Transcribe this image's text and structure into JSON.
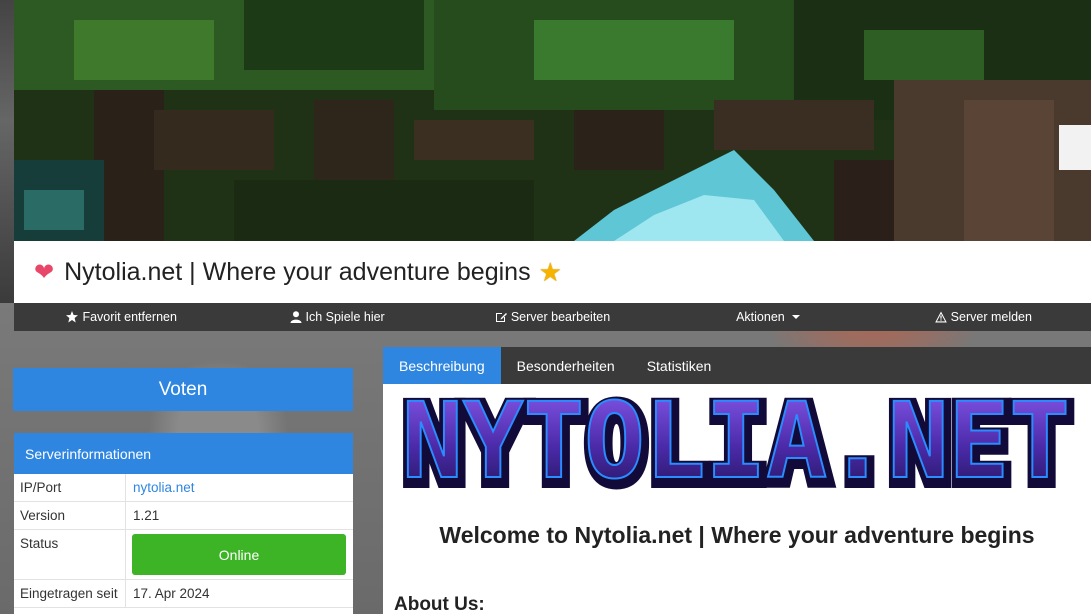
{
  "server": {
    "title": "Nytolia.net | Where your adventure begins",
    "heart_icon": "heart-icon",
    "star_icon": "star-icon"
  },
  "actions": [
    {
      "label": "Favorit entfernen",
      "icon": "star-icon"
    },
    {
      "label": "Ich Spiele hier",
      "icon": "user-icon"
    },
    {
      "label": "Server bearbeiten",
      "icon": "edit-icon"
    },
    {
      "label": "Aktionen",
      "icon": "caret-down-icon"
    },
    {
      "label": "Server melden",
      "icon": "warning-icon"
    }
  ],
  "vote": {
    "label": "Voten"
  },
  "info": {
    "heading": "Serverinformationen",
    "rows": [
      {
        "key": "IP/Port",
        "value": "nytolia.net"
      },
      {
        "key": "Version",
        "value": "1.21"
      },
      {
        "key": "Status",
        "value": "Online"
      },
      {
        "key": "Eingetragen seit",
        "value": "17. Apr 2024"
      }
    ]
  },
  "tabs": [
    {
      "label": "Beschreibung",
      "active": true
    },
    {
      "label": "Besonderheiten",
      "active": false
    },
    {
      "label": "Statistiken",
      "active": false
    }
  ],
  "content": {
    "logo_text": "NYTOLIA.NET",
    "welcome": "Welcome to Nytolia.net | Where your adventure begins",
    "about_heading": "About Us:"
  },
  "colors": {
    "accent": "#2f86e0",
    "dark_bar": "#3a3a3a",
    "online": "#3db326",
    "logo_purple": "#6a35c9"
  }
}
